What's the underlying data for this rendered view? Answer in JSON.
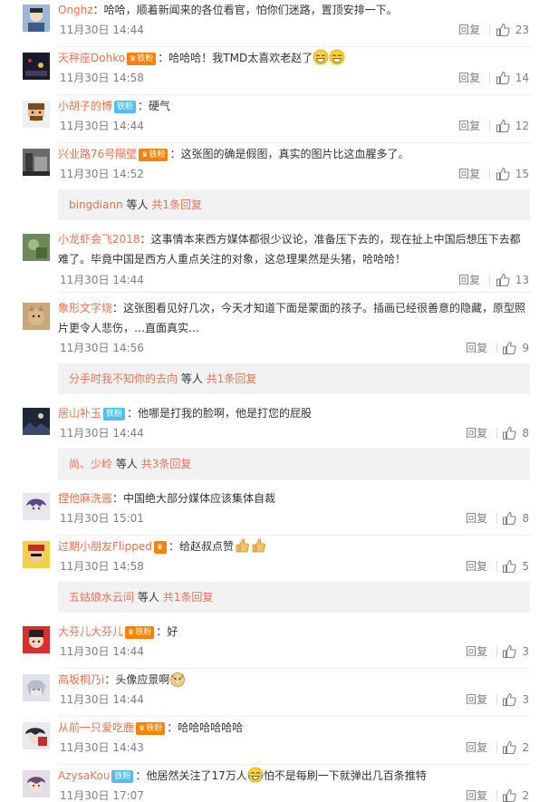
{
  "comments": [
    {
      "user": "Onghz",
      "badge": "",
      "text": "哈哈，顺着新闻来的各位看官，怕你们迷路，置顶安排一下。",
      "time": "11月30日 14:44",
      "reply": "回复",
      "likes": "23"
    },
    {
      "user": "天秤座Dohko",
      "badge": "铁粉",
      "text": "哈哈哈！我TMD太喜欢老赵了",
      "time": "11月30日 14:58",
      "reply": "回复",
      "likes": "14"
    },
    {
      "user": "小胡子的博",
      "badge": "铁粉",
      "text": "硬气",
      "time": "11月30日 14:44",
      "reply": "回复",
      "likes": "12"
    },
    {
      "user": "兴业路76号隔壁",
      "badge": "铁粉",
      "text": "这张图的确是假图，真实的图片比这血腥多了。",
      "time": "11月30日 14:52",
      "reply": "回复",
      "likes": "15"
    },
    {
      "user": "小龙虾会飞2018",
      "badge": "",
      "text": "这事情本来西方媒体都很少议论，准备压下去的，现在扯上中国后想压下去都难了。毕竟中国是西方人重点关注的对象，这总理果然是头猪，哈哈哈！",
      "time": "11月30日 14:44",
      "reply": "回复",
      "likes": "13"
    },
    {
      "user": "象形文字烧",
      "badge": "",
      "text": "这张图看见好几次，今天才知道下面是蒙面的孩子。插画已经很善意的隐藏，原型照片更令人悲伤，…直面真实…",
      "time": "11月30日 14:56",
      "reply": "回复",
      "likes": "9"
    },
    {
      "user": "居山补玉",
      "badge": "铁粉",
      "text": "他哪是打我的脸啊，他是打您的屁股",
      "time": "11月30日 14:44",
      "reply": "回复",
      "likes": "8"
    },
    {
      "user": "捏他麻洗酱",
      "badge": "",
      "text": "中国绝大部分媒体应该集体自裁",
      "time": "11月30日 15:01",
      "reply": "回复",
      "likes": "8"
    },
    {
      "user": "过期小朋友Flipped",
      "badge": "",
      "text": "给赵叔点赞",
      "time": "11月30日 14:58",
      "reply": "回复",
      "likes": "5"
    },
    {
      "user": "大芬儿大芬儿",
      "badge": "铁粉",
      "text": "好",
      "time": "11月30日 14:44",
      "reply": "回复",
      "likes": "3"
    },
    {
      "user": "高坂桐乃i",
      "badge": "",
      "text": "头像应景啊",
      "time": "11月30日 14:44",
      "reply": "回复",
      "likes": "3"
    },
    {
      "user": "从前一只爱吃鹿",
      "badge": "铁粉",
      "text": "哈哈哈哈哈哈",
      "time": "11月30日 14:43",
      "reply": "回复",
      "likes": "2"
    },
    {
      "user": "AzysaKou",
      "badge": "铁粉",
      "text_a": "他居然关注了17万人",
      "text_b": "怕不是每刷一下就弹出几百条推特",
      "time": "11月30日 17:07",
      "reply": "回复",
      "likes": "2"
    }
  ],
  "subreplies": [
    {
      "names": "bingdiann",
      "suffix": "等人",
      "count": "共1条回复"
    },
    {
      "names": "分手时我不知你的去向",
      "suffix": "等人",
      "count": "共1条回复"
    },
    {
      "names": "尚、少岭",
      "suffix": "等人",
      "count": "共3条回复"
    },
    {
      "names": "五姑娘水云间",
      "suffix": "等人",
      "count": "共1条回复"
    }
  ],
  "colors": {
    "username": "#eb7350",
    "badge_tie": "#55bef0",
    "badge_fan": "#ff8200",
    "muted": "#808080",
    "subbox_bg": "#f2f2f5"
  },
  "icons": {
    "like": "thumb-up-icon",
    "emoji_laugh": "grin-emoji-icon",
    "emoji_thumb": "thumbs-up-emoji-icon",
    "emoji_dog": "doge-emoji-icon",
    "emoji_tears": "tears-of-joy-emoji-icon"
  }
}
